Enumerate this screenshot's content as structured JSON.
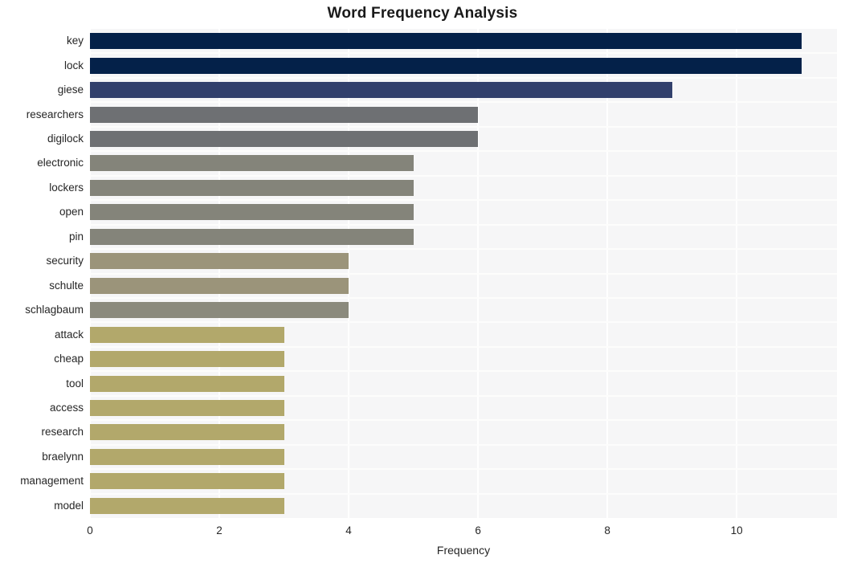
{
  "chart_data": {
    "type": "bar",
    "orientation": "horizontal",
    "title": "Word Frequency Analysis",
    "xlabel": "Frequency",
    "ylabel": "",
    "xlim": [
      0,
      11.55
    ],
    "xticks": [
      0,
      2,
      4,
      6,
      8,
      10
    ],
    "xtick_labels": [
      "0",
      "2",
      "4",
      "6",
      "8",
      "10"
    ],
    "grid": true,
    "legend": "none",
    "categories": [
      "key",
      "lock",
      "giese",
      "researchers",
      "digilock",
      "electronic",
      "lockers",
      "open",
      "pin",
      "security",
      "schulte",
      "schlagbaum",
      "attack",
      "cheap",
      "tool",
      "access",
      "research",
      "braelynn",
      "management",
      "model"
    ],
    "values": [
      11,
      11,
      9,
      6,
      6,
      5,
      5,
      5,
      5,
      4,
      4,
      4,
      3,
      3,
      3,
      3,
      3,
      3,
      3,
      3
    ],
    "bar_colors": [
      "#042149",
      "#042149",
      "#32406c",
      "#6e7073",
      "#6e7073",
      "#84847a",
      "#84847a",
      "#84847a",
      "#84847a",
      "#9b947a",
      "#9b947a",
      "#8b8a7d",
      "#b2a86b",
      "#b2a86b",
      "#b2a86b",
      "#b2a86b",
      "#b2a86b",
      "#b2a86b",
      "#b2a86b",
      "#b2a86b"
    ],
    "plot_background": "#f6f6f7",
    "figure_background": "#ffffff",
    "gridline_color": "#ffffff",
    "text_color": "#262626"
  }
}
